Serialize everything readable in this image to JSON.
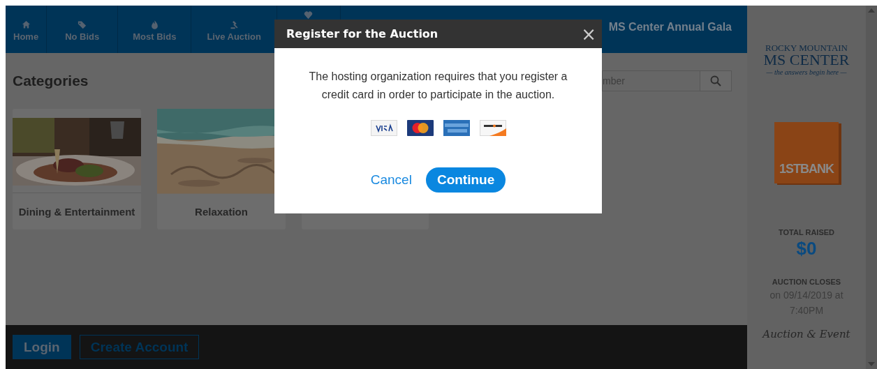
{
  "nav": [
    {
      "label": "Home"
    },
    {
      "label": "No Bids"
    },
    {
      "label": "Most Bids"
    },
    {
      "label": "Live Auction"
    }
  ],
  "event_title": "MS Center Annual Gala",
  "categories_title": "Categories",
  "search": {
    "placeholder": "mber"
  },
  "categories": [
    {
      "label": "Dining & Entertainment",
      "kind": "picture"
    },
    {
      "label": "Relaxation",
      "kind": "picture"
    }
  ],
  "footer": {
    "login": "Login",
    "create_account": "Create Account"
  },
  "sidebar": {
    "logo_lines": [
      "ROCKY MOUNTAIN",
      "MS CENTER",
      "— the answers begin here —"
    ],
    "sponsor": "1STBANK",
    "total_label": "TOTAL RAISED",
    "total": "$0",
    "closes_label": "AUCTION CLOSES",
    "closes": "on 09/14/2019 at 7:40PM",
    "footer_logo": "Auction & Event"
  },
  "modal": {
    "title": "Register for the Auction",
    "close": "×",
    "message": "The hosting organization requires that you register a credit card in order to participate in the auction.",
    "cancel": "Cancel",
    "continue": "Continue"
  }
}
